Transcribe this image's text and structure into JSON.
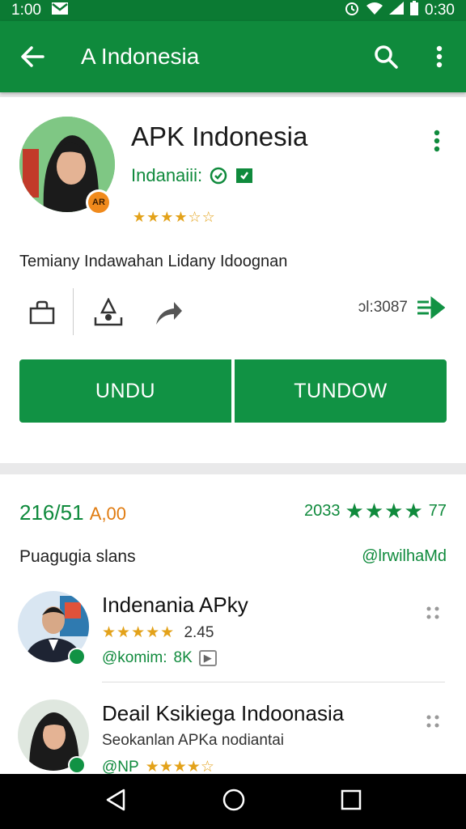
{
  "status_bar": {
    "time": "1:00",
    "right_time": "0:30"
  },
  "app_bar": {
    "title": "A Indonesia"
  },
  "app": {
    "name": "APK Indonesia",
    "developer": "Indanaiii:",
    "rating_stars": "★★★★☆☆",
    "avatar_badge": "AR",
    "description": "Temiany Indawahan Lidany Idoognan",
    "install_count": "ɔl:3087"
  },
  "buttons": {
    "left": "UNDU",
    "right": "TUNDOW"
  },
  "stats": {
    "left_number": "216/51",
    "left_accent": "A,00",
    "right_number": "2033",
    "right_stars": "★★★★",
    "right_tail": "77"
  },
  "section": {
    "label": "Puagugia slans",
    "link": "@lrwilhaMd"
  },
  "items": [
    {
      "title": "Indenania APky",
      "stars": "★★★★★",
      "rating": "2.45",
      "meta": "@komim:",
      "size": "8K",
      "tag": "▶"
    },
    {
      "title": "Deail Ksikiega Indoonasia",
      "subtitle": "Seokanlan APKa nodiantai",
      "meta": "@NP",
      "stars": "★★★★☆"
    }
  ],
  "colors": {
    "primary": "#0f8a3c",
    "status": "#0b7a33",
    "star": "#e3a21a",
    "accent": "#e07b10"
  }
}
